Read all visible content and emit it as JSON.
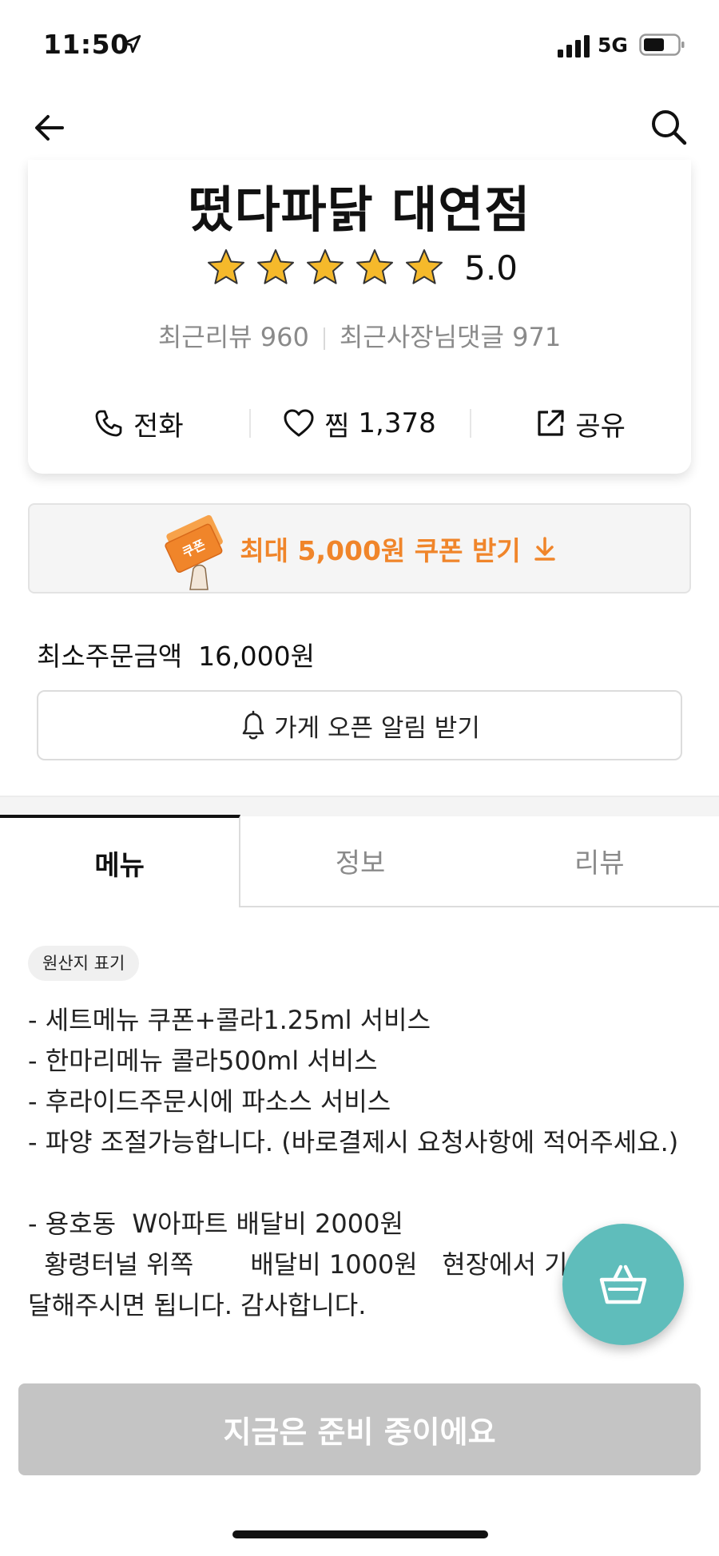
{
  "status_bar": {
    "time": "11:50",
    "network": "5G"
  },
  "store": {
    "name": "떴다파닭 대연점",
    "rating": "5.0",
    "rating_stars": 5,
    "recent_reviews_label": "최근리뷰",
    "recent_reviews_count": "960",
    "owner_replies_label": "최근사장님댓글",
    "owner_replies_count": "971"
  },
  "actions": {
    "call": "전화",
    "like_label": "찜",
    "like_count": "1,378",
    "share": "공유"
  },
  "coupon": {
    "text": "최대 5,000원 쿠폰 받기",
    "image_label": "쿠폰"
  },
  "min_order": {
    "label": "최소주문금액",
    "value": "16,000원"
  },
  "notify_button": "가게 오픈 알림 받기",
  "tabs": [
    {
      "label": "메뉴",
      "active": true
    },
    {
      "label": "정보",
      "active": false
    },
    {
      "label": "리뷰",
      "active": false
    }
  ],
  "origin_badge": "원산지 표기",
  "notice": "- 세트메뉴 쿠폰+콜라1.25ml 서비스\n- 한마리메뉴 콜라500ml 서비스\n- 후라이드주문시에 파소스 서비스\n- 파양 조절가능합니다. (바로결제시 요청사항에 적어주세요.)\n\n- 용호동  W아파트 배달비 2000원\n  황령터널 위쪽       배달비 1000원   현장에서 기사님께 전달해주시면 됩니다. 감사합니다.",
  "bottom_button": "지금은 준비 중이에요",
  "colors": {
    "accent_orange": "#f0852a",
    "fab_teal": "#5fbdbb",
    "disabled_gray": "#c4c4c4",
    "star_gold": "#f5b92b"
  },
  "icons": [
    "back-arrow-icon",
    "search-icon",
    "star-icon",
    "phone-icon",
    "heart-icon",
    "share-icon",
    "download-icon",
    "bell-icon",
    "basket-icon"
  ]
}
